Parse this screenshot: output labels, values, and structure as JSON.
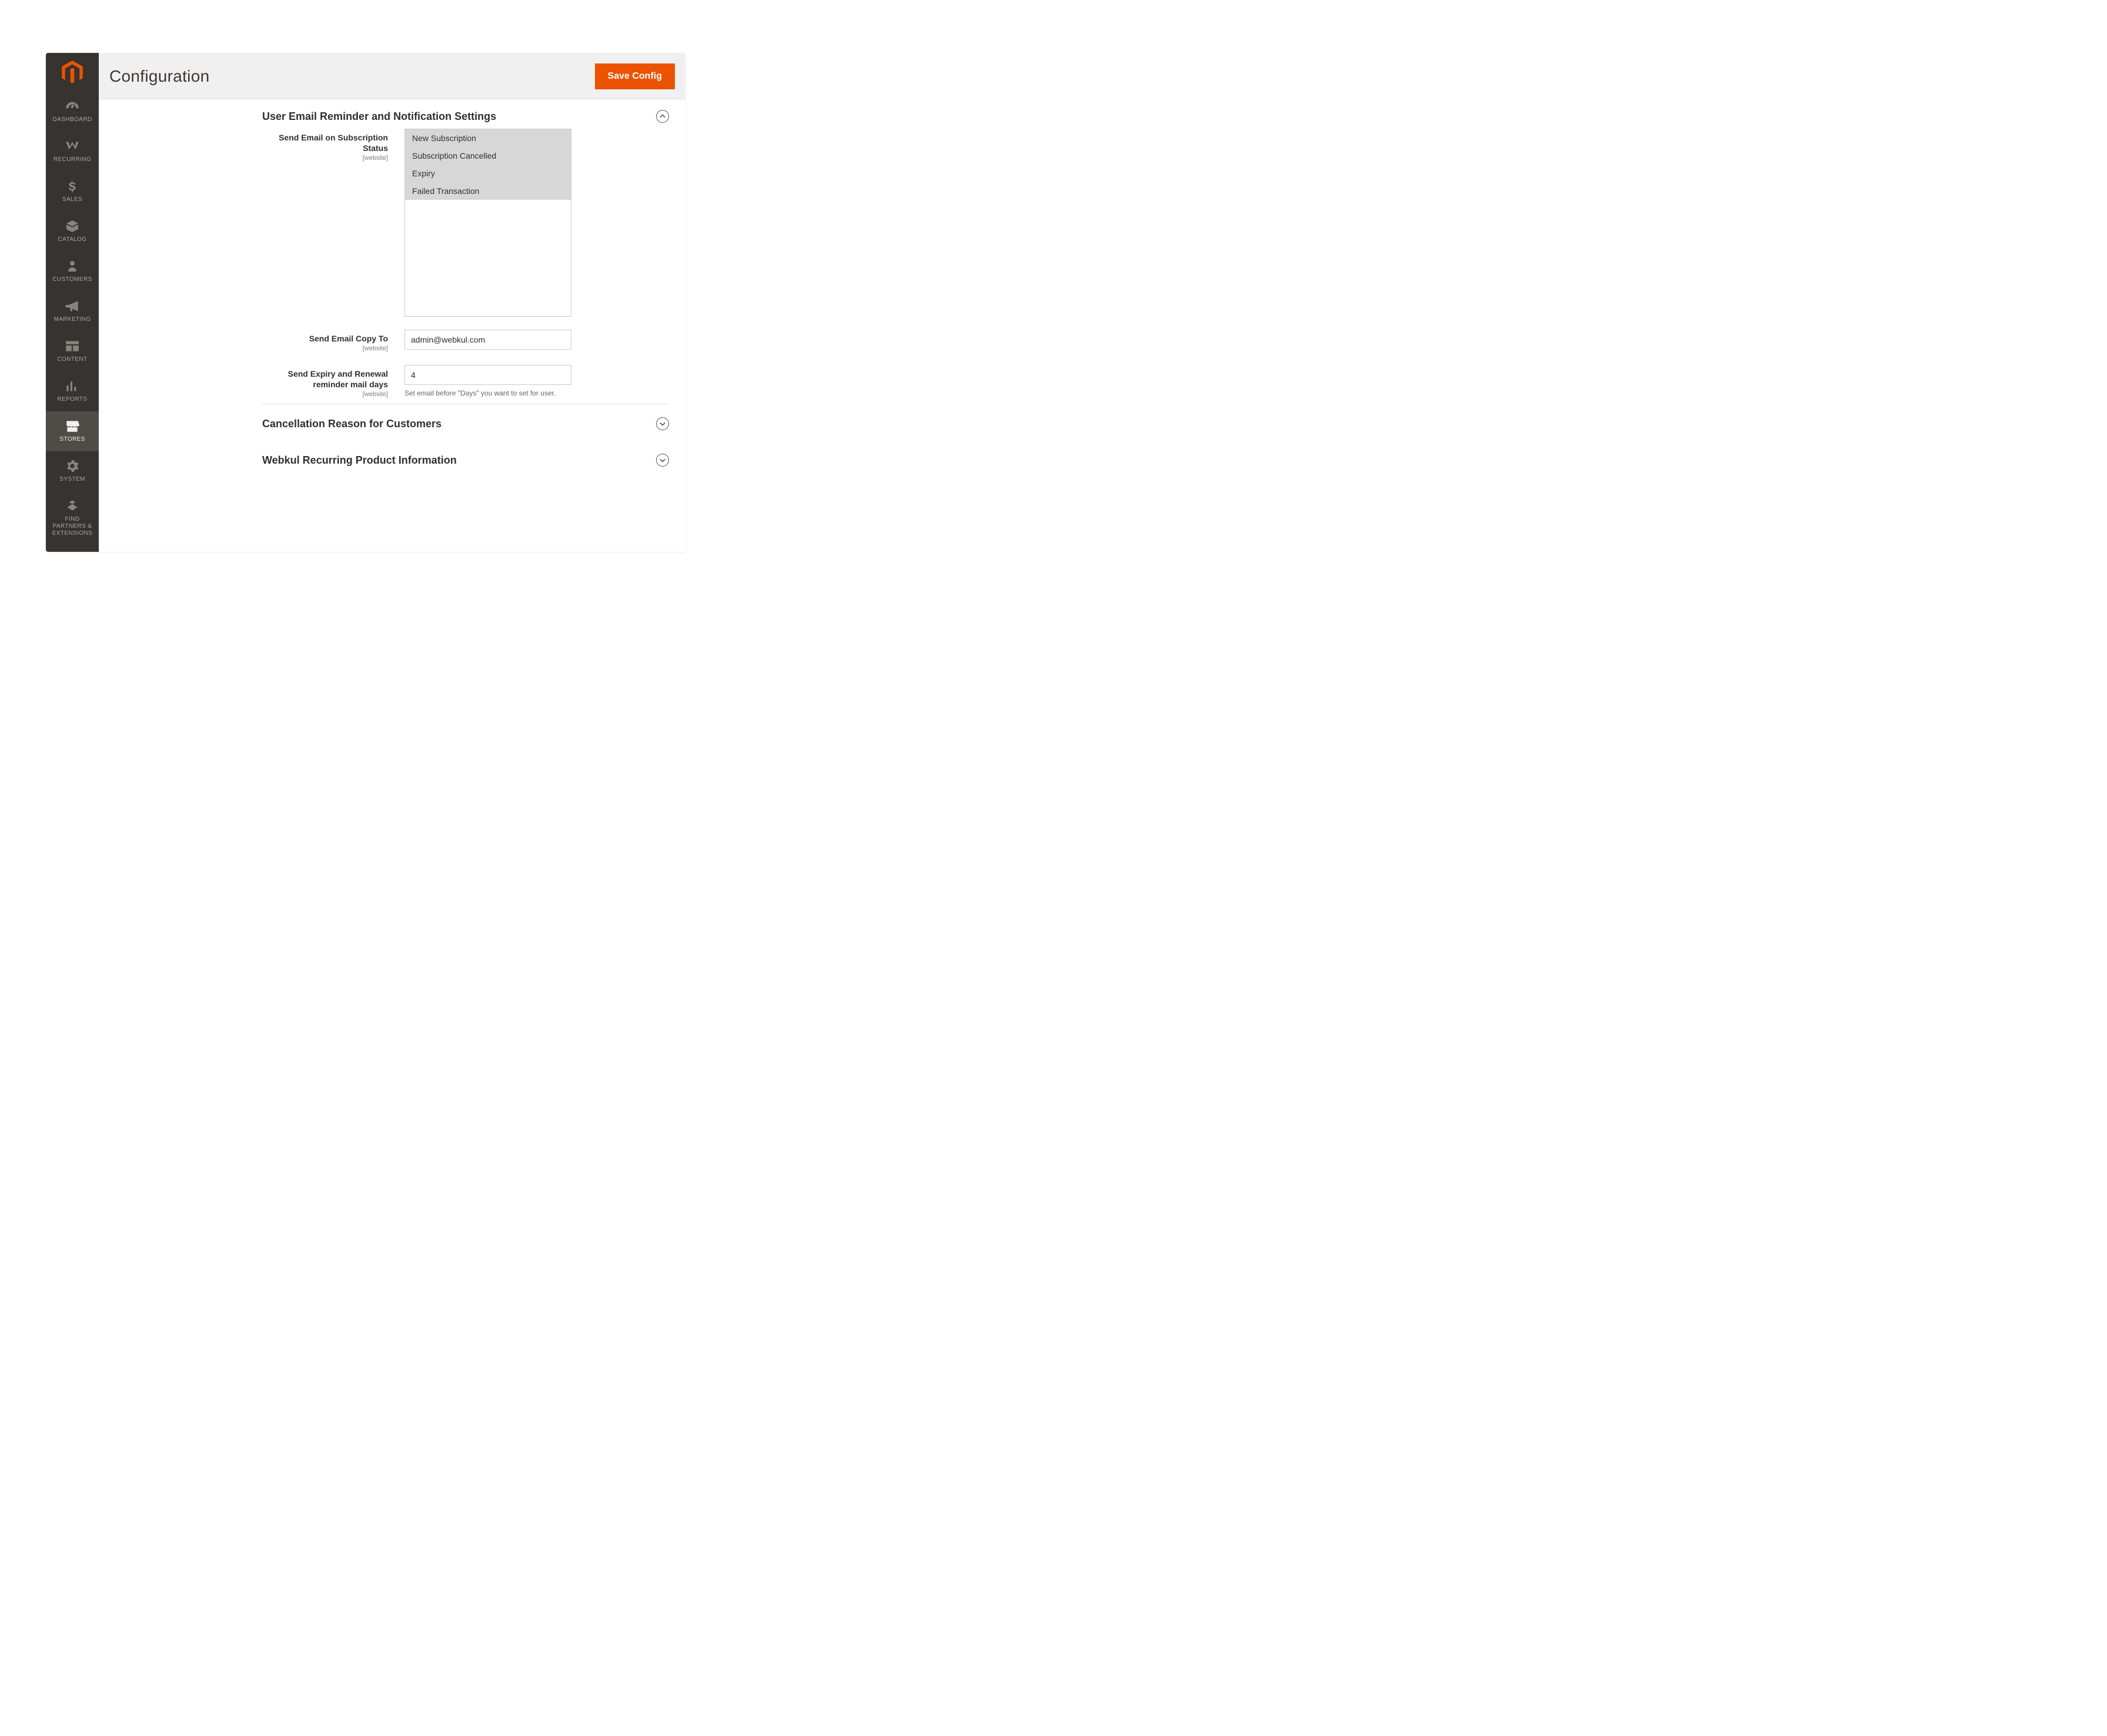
{
  "page": {
    "title": "Configuration",
    "save_label": "Save Config"
  },
  "sidebar": {
    "items": [
      {
        "key": "dashboard",
        "label": "DASHBOARD"
      },
      {
        "key": "recurring",
        "label": "RECURRING"
      },
      {
        "key": "sales",
        "label": "SALES"
      },
      {
        "key": "catalog",
        "label": "CATALOG"
      },
      {
        "key": "customers",
        "label": "CUSTOMERS"
      },
      {
        "key": "marketing",
        "label": "MARKETING"
      },
      {
        "key": "content",
        "label": "CONTENT"
      },
      {
        "key": "reports",
        "label": "REPORTS"
      },
      {
        "key": "stores",
        "label": "STORES"
      },
      {
        "key": "system",
        "label": "SYSTEM"
      },
      {
        "key": "partners",
        "label": "FIND PARTNERS & EXTENSIONS"
      }
    ],
    "active_key": "stores"
  },
  "sections": {
    "email_reminder": {
      "title": "User Email Reminder and Notification Settings",
      "expanded": true,
      "fields": {
        "status": {
          "label": "Send Email on Subscription Status",
          "scope": "[website]",
          "options": [
            {
              "value": "new",
              "label": "New Subscription",
              "selected": true
            },
            {
              "value": "cancelled",
              "label": "Subscription Cancelled",
              "selected": true
            },
            {
              "value": "expiry",
              "label": "Expiry",
              "selected": true
            },
            {
              "value": "failed",
              "label": "Failed Transaction",
              "selected": true
            }
          ]
        },
        "copy_to": {
          "label": "Send Email Copy To",
          "scope": "[website]",
          "value": "admin@webkul.com"
        },
        "reminder_days": {
          "label": "Send Expiry and Renewal reminder mail days",
          "scope": "[website]",
          "value": "4",
          "help": "Set email before \"Days\" you want to set for user."
        }
      }
    },
    "cancellation": {
      "title": "Cancellation Reason for Customers",
      "expanded": false
    },
    "product_info": {
      "title": "Webkul Recurring Product Information",
      "expanded": false
    }
  }
}
